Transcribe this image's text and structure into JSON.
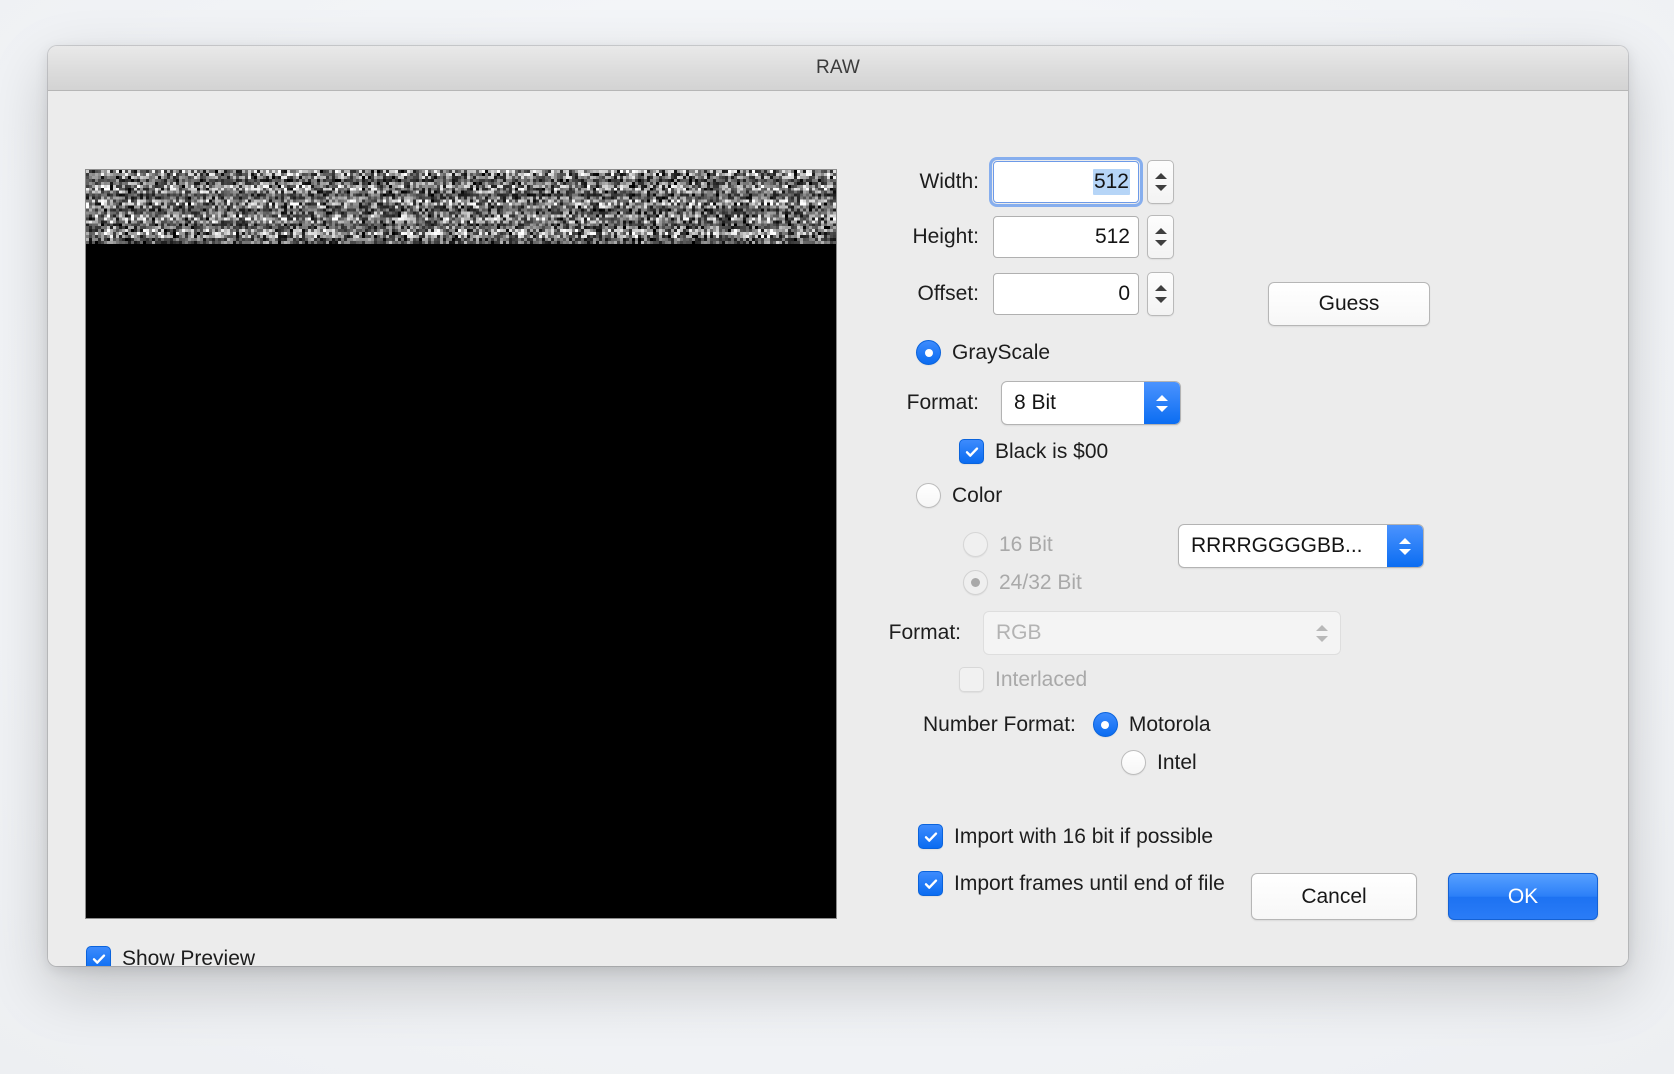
{
  "window": {
    "title": "RAW"
  },
  "preview": {
    "show_preview_label": "Show Preview",
    "show_preview_checked": true
  },
  "dimensions": {
    "width_label": "Width:",
    "width_value": "512",
    "height_label": "Height:",
    "height_value": "512",
    "offset_label": "Offset:",
    "offset_value": "0",
    "guess_label": "Guess"
  },
  "grayscale": {
    "radio_label": "GrayScale",
    "selected": true,
    "format_label": "Format:",
    "format_value": "8 Bit",
    "black_is_label": "Black is $00",
    "black_is_checked": true
  },
  "color": {
    "radio_label": "Color",
    "selected": false,
    "bit16_label": "16 Bit",
    "bit16_selected": false,
    "bit2432_label": "24/32 Bit",
    "bit2432_selected": true,
    "channel_order_value": "RRRRGGGGBB...",
    "format_label": "Format:",
    "format_value": "RGB",
    "interlaced_label": "Interlaced",
    "interlaced_checked": false
  },
  "number_format": {
    "label": "Number Format:",
    "motorola_label": "Motorola",
    "motorola_selected": true,
    "intel_label": "Intel",
    "intel_selected": false
  },
  "import_options": {
    "import16_label": "Import with 16 bit if possible",
    "import16_checked": true,
    "frames_label": "Import frames until end of file",
    "frames_checked": true
  },
  "actions": {
    "cancel_label": "Cancel",
    "ok_label": "OK"
  },
  "colors": {
    "accent": "#0a6cf1",
    "window_bg": "#ececec",
    "titlebar_top": "#e9e9e9",
    "selection_highlight": "#b6d5f7",
    "disabled_text": "#a9a9a9"
  }
}
